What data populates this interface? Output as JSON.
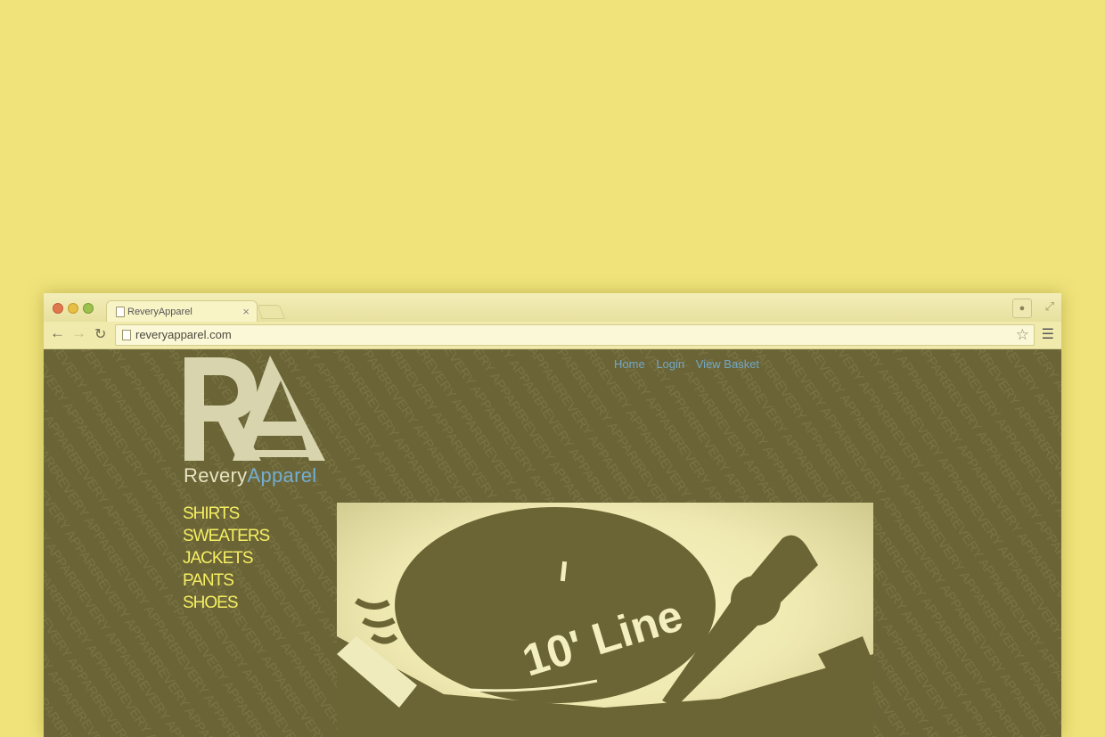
{
  "browser": {
    "tab": {
      "title": "ReveryApparel",
      "close": "×"
    },
    "url": "reveryapparel.com"
  },
  "site": {
    "nav": [
      "Home",
      "Login",
      "View Basket"
    ],
    "brand": {
      "part1": "Revery",
      "part2": "Apparel"
    },
    "categories": [
      "SHIRTS",
      "SWEATERS",
      "JACKETS",
      "PANTS",
      "SHOES"
    ],
    "pattern_text": "REVERY APPAREL",
    "hero": {
      "caption": "10' Line"
    }
  },
  "colors": {
    "background": "#f0e37a",
    "page": "#6a6437",
    "accent_blue": "#74aed0",
    "category_yellow": "#f6ef63",
    "logo_cream": "#d8d4ad"
  },
  "icons": {
    "close": "close-icon",
    "back": "back-arrow-icon",
    "forward": "forward-arrow-icon",
    "reload": "reload-icon",
    "star": "star-icon",
    "menu": "hamburger-menu-icon",
    "profile": "profile-icon",
    "fullscreen": "fullscreen-icon",
    "page": "page-icon"
  }
}
